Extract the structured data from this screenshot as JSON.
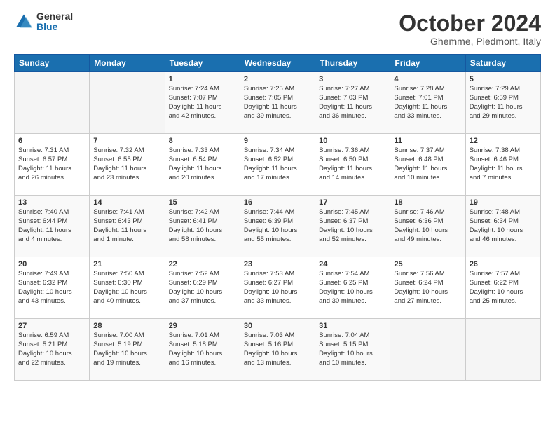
{
  "header": {
    "logo_general": "General",
    "logo_blue": "Blue",
    "month_title": "October 2024",
    "subtitle": "Ghemme, Piedmont, Italy"
  },
  "columns": [
    "Sunday",
    "Monday",
    "Tuesday",
    "Wednesday",
    "Thursday",
    "Friday",
    "Saturday"
  ],
  "weeks": [
    [
      {
        "day": "",
        "lines": []
      },
      {
        "day": "",
        "lines": []
      },
      {
        "day": "1",
        "lines": [
          "Sunrise: 7:24 AM",
          "Sunset: 7:07 PM",
          "Daylight: 11 hours",
          "and 42 minutes."
        ]
      },
      {
        "day": "2",
        "lines": [
          "Sunrise: 7:25 AM",
          "Sunset: 7:05 PM",
          "Daylight: 11 hours",
          "and 39 minutes."
        ]
      },
      {
        "day": "3",
        "lines": [
          "Sunrise: 7:27 AM",
          "Sunset: 7:03 PM",
          "Daylight: 11 hours",
          "and 36 minutes."
        ]
      },
      {
        "day": "4",
        "lines": [
          "Sunrise: 7:28 AM",
          "Sunset: 7:01 PM",
          "Daylight: 11 hours",
          "and 33 minutes."
        ]
      },
      {
        "day": "5",
        "lines": [
          "Sunrise: 7:29 AM",
          "Sunset: 6:59 PM",
          "Daylight: 11 hours",
          "and 29 minutes."
        ]
      }
    ],
    [
      {
        "day": "6",
        "lines": [
          "Sunrise: 7:31 AM",
          "Sunset: 6:57 PM",
          "Daylight: 11 hours",
          "and 26 minutes."
        ]
      },
      {
        "day": "7",
        "lines": [
          "Sunrise: 7:32 AM",
          "Sunset: 6:55 PM",
          "Daylight: 11 hours",
          "and 23 minutes."
        ]
      },
      {
        "day": "8",
        "lines": [
          "Sunrise: 7:33 AM",
          "Sunset: 6:54 PM",
          "Daylight: 11 hours",
          "and 20 minutes."
        ]
      },
      {
        "day": "9",
        "lines": [
          "Sunrise: 7:34 AM",
          "Sunset: 6:52 PM",
          "Daylight: 11 hours",
          "and 17 minutes."
        ]
      },
      {
        "day": "10",
        "lines": [
          "Sunrise: 7:36 AM",
          "Sunset: 6:50 PM",
          "Daylight: 11 hours",
          "and 14 minutes."
        ]
      },
      {
        "day": "11",
        "lines": [
          "Sunrise: 7:37 AM",
          "Sunset: 6:48 PM",
          "Daylight: 11 hours",
          "and 10 minutes."
        ]
      },
      {
        "day": "12",
        "lines": [
          "Sunrise: 7:38 AM",
          "Sunset: 6:46 PM",
          "Daylight: 11 hours",
          "and 7 minutes."
        ]
      }
    ],
    [
      {
        "day": "13",
        "lines": [
          "Sunrise: 7:40 AM",
          "Sunset: 6:44 PM",
          "Daylight: 11 hours",
          "and 4 minutes."
        ]
      },
      {
        "day": "14",
        "lines": [
          "Sunrise: 7:41 AM",
          "Sunset: 6:43 PM",
          "Daylight: 11 hours",
          "and 1 minute."
        ]
      },
      {
        "day": "15",
        "lines": [
          "Sunrise: 7:42 AM",
          "Sunset: 6:41 PM",
          "Daylight: 10 hours",
          "and 58 minutes."
        ]
      },
      {
        "day": "16",
        "lines": [
          "Sunrise: 7:44 AM",
          "Sunset: 6:39 PM",
          "Daylight: 10 hours",
          "and 55 minutes."
        ]
      },
      {
        "day": "17",
        "lines": [
          "Sunrise: 7:45 AM",
          "Sunset: 6:37 PM",
          "Daylight: 10 hours",
          "and 52 minutes."
        ]
      },
      {
        "day": "18",
        "lines": [
          "Sunrise: 7:46 AM",
          "Sunset: 6:36 PM",
          "Daylight: 10 hours",
          "and 49 minutes."
        ]
      },
      {
        "day": "19",
        "lines": [
          "Sunrise: 7:48 AM",
          "Sunset: 6:34 PM",
          "Daylight: 10 hours",
          "and 46 minutes."
        ]
      }
    ],
    [
      {
        "day": "20",
        "lines": [
          "Sunrise: 7:49 AM",
          "Sunset: 6:32 PM",
          "Daylight: 10 hours",
          "and 43 minutes."
        ]
      },
      {
        "day": "21",
        "lines": [
          "Sunrise: 7:50 AM",
          "Sunset: 6:30 PM",
          "Daylight: 10 hours",
          "and 40 minutes."
        ]
      },
      {
        "day": "22",
        "lines": [
          "Sunrise: 7:52 AM",
          "Sunset: 6:29 PM",
          "Daylight: 10 hours",
          "and 37 minutes."
        ]
      },
      {
        "day": "23",
        "lines": [
          "Sunrise: 7:53 AM",
          "Sunset: 6:27 PM",
          "Daylight: 10 hours",
          "and 33 minutes."
        ]
      },
      {
        "day": "24",
        "lines": [
          "Sunrise: 7:54 AM",
          "Sunset: 6:25 PM",
          "Daylight: 10 hours",
          "and 30 minutes."
        ]
      },
      {
        "day": "25",
        "lines": [
          "Sunrise: 7:56 AM",
          "Sunset: 6:24 PM",
          "Daylight: 10 hours",
          "and 27 minutes."
        ]
      },
      {
        "day": "26",
        "lines": [
          "Sunrise: 7:57 AM",
          "Sunset: 6:22 PM",
          "Daylight: 10 hours",
          "and 25 minutes."
        ]
      }
    ],
    [
      {
        "day": "27",
        "lines": [
          "Sunrise: 6:59 AM",
          "Sunset: 5:21 PM",
          "Daylight: 10 hours",
          "and 22 minutes."
        ]
      },
      {
        "day": "28",
        "lines": [
          "Sunrise: 7:00 AM",
          "Sunset: 5:19 PM",
          "Daylight: 10 hours",
          "and 19 minutes."
        ]
      },
      {
        "day": "29",
        "lines": [
          "Sunrise: 7:01 AM",
          "Sunset: 5:18 PM",
          "Daylight: 10 hours",
          "and 16 minutes."
        ]
      },
      {
        "day": "30",
        "lines": [
          "Sunrise: 7:03 AM",
          "Sunset: 5:16 PM",
          "Daylight: 10 hours",
          "and 13 minutes."
        ]
      },
      {
        "day": "31",
        "lines": [
          "Sunrise: 7:04 AM",
          "Sunset: 5:15 PM",
          "Daylight: 10 hours",
          "and 10 minutes."
        ]
      },
      {
        "day": "",
        "lines": []
      },
      {
        "day": "",
        "lines": []
      }
    ]
  ]
}
